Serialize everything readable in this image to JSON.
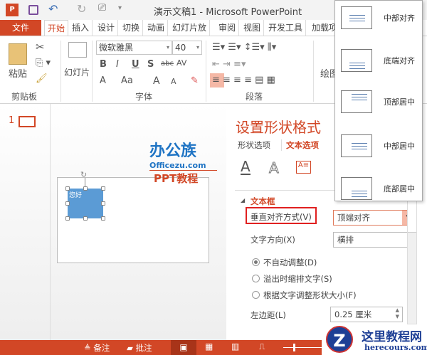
{
  "title": "演示文稿1 - Microsoft PowerPoint",
  "tabs": [
    "文件",
    "开始",
    "插入",
    "设计",
    "切换",
    "动画",
    "幻灯片放",
    "审阅",
    "视图",
    "开发工具",
    "加载项"
  ],
  "ribbon": {
    "clipboard": {
      "paste": "粘贴",
      "label": "剪贴板"
    },
    "slides": {
      "new_slide": "幻灯片"
    },
    "font": {
      "name": "微软雅黑",
      "size": "40",
      "label": "字体",
      "bold": "B",
      "italic": "I",
      "underline": "U",
      "shadow": "S",
      "strike": "abc",
      "spacing": "AV",
      "color": "A",
      "case": "Aa",
      "grow": "A",
      "shrink": "A"
    },
    "paragraph": {
      "label": "段落"
    },
    "drawing": {
      "label": "绘图"
    }
  },
  "thumbnail_number": "1",
  "slide": {
    "shape_text": "您好",
    "logo_text": "办公族",
    "logo_url": "Officezu.com",
    "logo_sub": "PPT教程"
  },
  "pane": {
    "title": "设置形状格式",
    "tabs": [
      "形状选项",
      "文本选项"
    ],
    "section": "文本框",
    "valign_label": "垂直对齐方式(V)",
    "valign_value": "顶端对齐",
    "direction_label": "文字方向(X)",
    "direction_value": "横排",
    "radios": [
      "不自动调整(D)",
      "溢出时缩排文字(S)",
      "根据文字调整形状大小(F)"
    ],
    "left_margin_label": "左边距(L)",
    "left_margin_value": "0.25 厘米"
  },
  "dropdown": [
    "中部对齐",
    "底端对齐",
    "顶部居中",
    "中部居中",
    "底部居中"
  ],
  "status": {
    "notes": "备注",
    "comments": "批注"
  },
  "watermark": {
    "name": "这里教程网",
    "url": "herecours.com"
  },
  "colors": {
    "accent": "#d24726",
    "shape": "#5b9bd5"
  }
}
